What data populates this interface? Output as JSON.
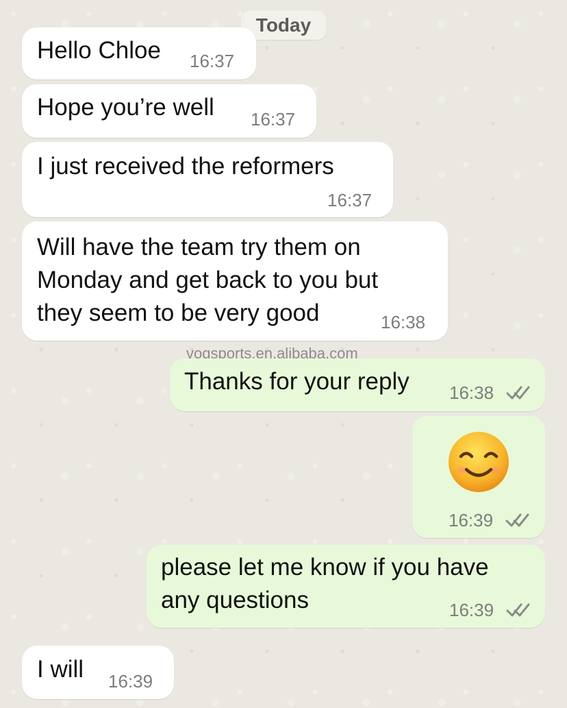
{
  "chat": {
    "date_label": "Today",
    "watermark": "vogsports.en.alibaba.com",
    "messages": [
      {
        "text": "Hello Chloe",
        "time": "16:37",
        "direction": "incoming"
      },
      {
        "text": "Hope you’re well",
        "time": "16:37",
        "direction": "incoming"
      },
      {
        "text": "I just received the reformers",
        "time": "16:37",
        "direction": "incoming"
      },
      {
        "text_lines": [
          "Will have the team try them on",
          "Monday and get back to you but",
          "they seem to be very good"
        ],
        "time": "16:38",
        "direction": "incoming"
      },
      {
        "text": "Thanks for your reply",
        "time": "16:38",
        "direction": "outgoing"
      },
      {
        "emoji": "smiling-face-with-smiling-eyes",
        "time": "16:39",
        "direction": "outgoing"
      },
      {
        "text_lines": [
          "please let me know if you have",
          "any questions"
        ],
        "time": "16:39",
        "direction": "outgoing"
      },
      {
        "text": "I will",
        "time": "16:39",
        "direction": "incoming"
      }
    ]
  },
  "colors": {
    "incoming_bubble": "#ffffff",
    "outgoing_bubble": "#e8f9d9",
    "timestamp": "#7d7d7d",
    "read_ticks": "#8a8a8a"
  },
  "icons": {
    "read_receipt": "double-check-icon",
    "emoji": "smiling-face-with-smiling-eyes-icon"
  }
}
